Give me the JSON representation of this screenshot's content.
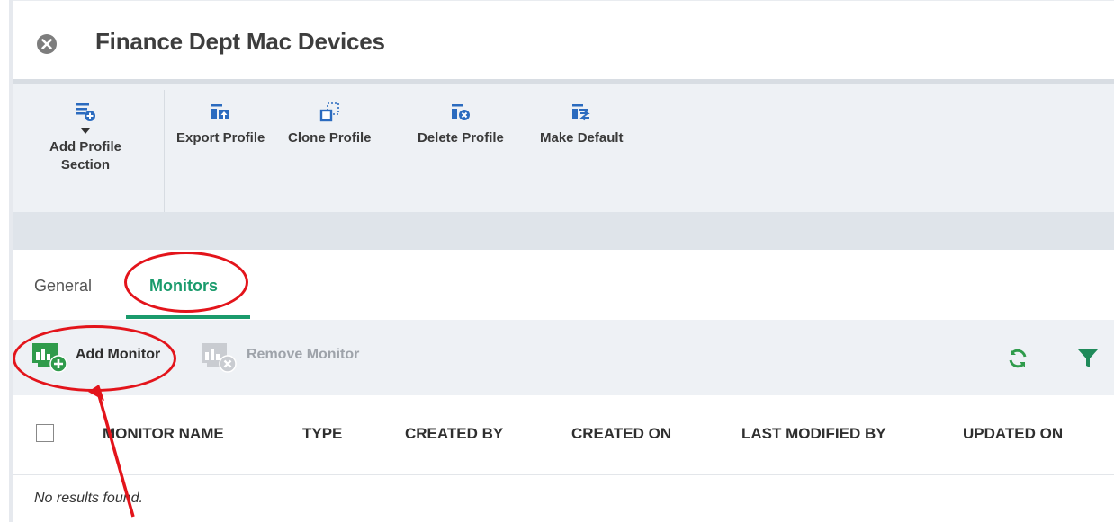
{
  "window": {
    "title": "Finance Dept Mac Devices",
    "close_icon": "close-circle-icon"
  },
  "toolbar": {
    "items": [
      {
        "label": "Add Profile Section",
        "icon": "add-section-icon",
        "has_dropdown": true
      },
      {
        "label": "Export Profile",
        "icon": "export-icon"
      },
      {
        "label": "Clone Profile",
        "icon": "clone-icon"
      },
      {
        "label": "Delete Profile",
        "icon": "delete-profile-icon"
      },
      {
        "label": "Make Default",
        "icon": "make-default-icon"
      }
    ]
  },
  "tabs": {
    "items": [
      {
        "label": "General",
        "active": false
      },
      {
        "label": "Monitors",
        "active": true
      }
    ]
  },
  "actions": {
    "add_monitor": "Add Monitor",
    "remove_monitor": "Remove Monitor",
    "refresh_icon": "refresh-icon",
    "filter_icon": "filter-icon"
  },
  "table": {
    "columns": [
      "MONITOR NAME",
      "TYPE",
      "CREATED BY",
      "CREATED ON",
      "LAST MODIFIED BY",
      "UPDATED ON"
    ],
    "empty_message": "No results found."
  },
  "colors": {
    "accent_green": "#1a9b6c",
    "annotation_red": "#e3141b",
    "toolbar_bg": "#eef1f5"
  }
}
